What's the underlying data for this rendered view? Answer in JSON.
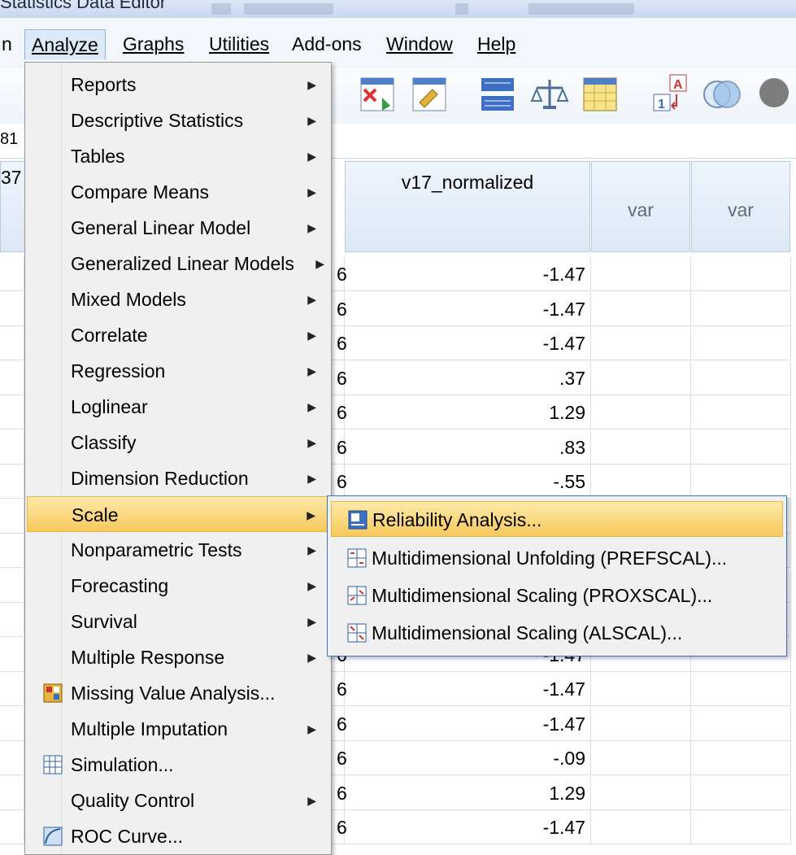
{
  "window": {
    "title": "Statistics Data Editor"
  },
  "menubar": {
    "items": [
      {
        "label": "n"
      },
      {
        "label": "Analyze"
      },
      {
        "label": "Graphs"
      },
      {
        "label": "Utilities"
      },
      {
        "label": "Add-ons"
      },
      {
        "label": "Window"
      },
      {
        "label": "Help"
      }
    ]
  },
  "cellref": {
    "text": "81"
  },
  "grid": {
    "partial_header": "37",
    "columns": [
      "v17_normalized",
      "var",
      "var"
    ],
    "left_fragment": "6",
    "rows": [
      {
        "value": "-1.47"
      },
      {
        "value": "-1.47"
      },
      {
        "value": "-1.47"
      },
      {
        "value": ".37"
      },
      {
        "value": "1.29"
      },
      {
        "value": ".83"
      },
      {
        "value": "-.55"
      },
      {
        "value": ""
      },
      {
        "value": ""
      },
      {
        "value": ""
      },
      {
        "value": ""
      },
      {
        "value": "-1.47"
      },
      {
        "value": "-1.47"
      },
      {
        "value": "-1.47"
      },
      {
        "value": "-.09"
      },
      {
        "value": "1.29"
      },
      {
        "value": "-1.47"
      }
    ]
  },
  "analyze_menu": {
    "items": [
      {
        "label": "Reports",
        "submenu": true
      },
      {
        "label": "Descriptive Statistics",
        "submenu": true
      },
      {
        "label": "Tables",
        "submenu": true
      },
      {
        "label": "Compare Means",
        "submenu": true
      },
      {
        "label": "General Linear Model",
        "submenu": true
      },
      {
        "label": "Generalized Linear Models",
        "submenu": true
      },
      {
        "label": "Mixed Models",
        "submenu": true
      },
      {
        "label": "Correlate",
        "submenu": true
      },
      {
        "label": "Regression",
        "submenu": true
      },
      {
        "label": "Loglinear",
        "submenu": true
      },
      {
        "label": "Classify",
        "submenu": true
      },
      {
        "label": "Dimension Reduction",
        "submenu": true
      },
      {
        "label": "Scale",
        "submenu": true,
        "highlighted": true
      },
      {
        "label": "Nonparametric Tests",
        "submenu": true
      },
      {
        "label": "Forecasting",
        "submenu": true
      },
      {
        "label": "Survival",
        "submenu": true
      },
      {
        "label": "Multiple Response",
        "submenu": true
      },
      {
        "label": "Missing Value Analysis...",
        "icon": "missing-value-icon"
      },
      {
        "label": "Multiple Imputation",
        "submenu": true
      },
      {
        "label": "Simulation...",
        "icon": "simulation-icon"
      },
      {
        "label": "Quality Control",
        "submenu": true
      },
      {
        "label": "ROC Curve..."
      }
    ]
  },
  "scale_submenu": {
    "items": [
      {
        "label": "Reliability Analysis...",
        "highlighted": true,
        "icon": "reliability-icon"
      },
      {
        "label": "Multidimensional Unfolding (PREFSCAL)...",
        "icon": "unfolding-icon"
      },
      {
        "label": "Multidimensional Scaling (PROXSCAL)...",
        "icon": "proxscal-icon"
      },
      {
        "label": "Multidimensional Scaling (ALSCAL)...",
        "icon": "alscal-icon"
      }
    ]
  },
  "colors": {
    "highlight": "#f7c95c",
    "menu_bg": "#f0f0f0",
    "submenu_border": "#3c73c4"
  }
}
